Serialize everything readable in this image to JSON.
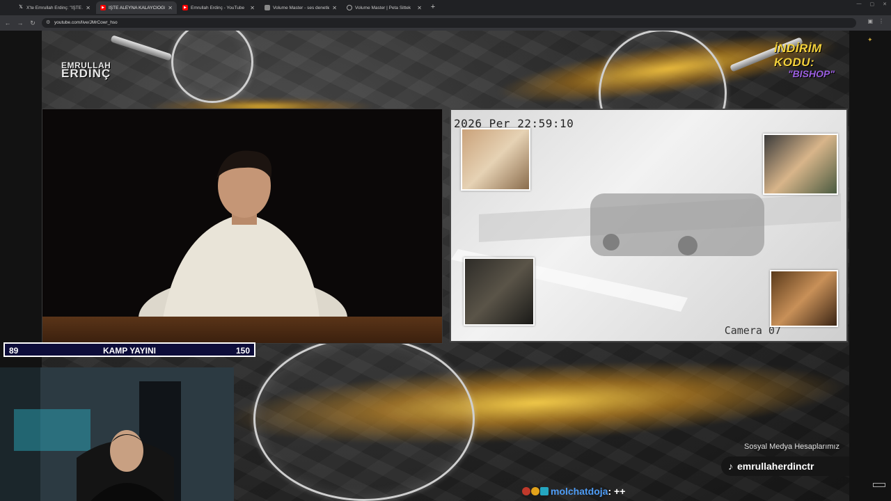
{
  "browser": {
    "tabs": [
      {
        "title": "X'te Emrullah Erdinç: \"İŞTE ALE",
        "favicon": "x-logo",
        "active": false
      },
      {
        "title": "İŞTE ALEYNA KALAYCIOĞLU",
        "favicon": "youtube-logo",
        "active": true
      },
      {
        "title": "Emrullah Erdinç - YouTube",
        "favicon": "youtube-logo",
        "active": false
      },
      {
        "title": "Volume Master - ses denetleyi",
        "favicon": "volume-master-icon",
        "active": false
      },
      {
        "title": "Volume Master | Peta Sittek",
        "favicon": "globe-icon",
        "active": false
      }
    ],
    "new_tab": "+",
    "url": "youtube.com/live/JMrCowr_hso"
  },
  "overlay": {
    "logo_line1": "EMRULLAH",
    "logo_line2": "ERDİNÇ",
    "promo_line1": "İNDİRİM KODU:",
    "promo_line2": "\"BISHOP\"",
    "counter_left": "89",
    "counter_title": "KAMP YAYINI",
    "counter_right": "150",
    "social_title": "Sosyal Medya Hesaplarımız",
    "social_handle": "emrullaherdinctr",
    "social_icon": "tiktok-icon"
  },
  "camera": {
    "timestamp": "2026 Per 22:59:10",
    "label": "Camera 07"
  },
  "chat": {
    "username": "molchatdoja",
    "message": ": ++"
  },
  "colors": {
    "accent_gold": "#f4d23c",
    "promo_purple": "#9b5fe0",
    "counter_bg": "#0d0d3a",
    "chat_user": "#4e9cf5"
  }
}
